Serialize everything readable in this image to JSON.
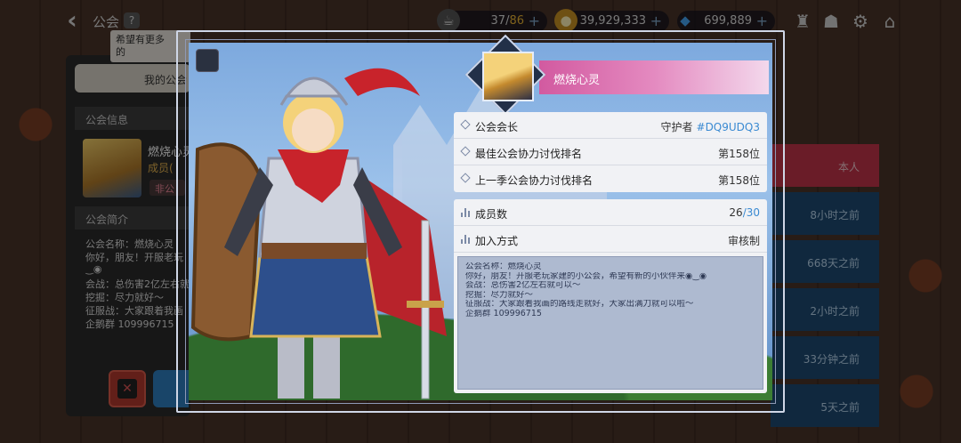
{
  "topbar": {
    "title": "公会",
    "help": "?",
    "stamina": {
      "current": "37",
      "max": "86"
    },
    "gold": "39,929,333",
    "gems": "699,889",
    "plus": "+"
  },
  "left_panel": {
    "tooltip": [
      "希望有更多",
      "的"
    ],
    "my_guild_tab": "我的公会",
    "guild_info_header": "公会信息",
    "leader_name": "燃烧心灵",
    "leader_sub": "成员(",
    "leader_tag": "非公",
    "intro_header": "公会简介",
    "intro_lines": [
      "公会名称：燃烧心灵",
      "你好，朋友！开服老玩",
      "‿◉",
      "会战：总伤害2亿左右就",
      "挖掘：尽力就好～",
      "征服战：大家跟着我画",
      "企鹅群 109996715"
    ]
  },
  "member_list": {
    "rows": [
      "本人",
      "8小时之前",
      "668天之前",
      "2小时之前",
      "33分钟之前",
      "5天之前"
    ]
  },
  "guild_card": {
    "name": "燃烧心灵",
    "rows": {
      "leader_label": "公会会长",
      "leader_role": "守护者",
      "leader_id": "#DQ9UDQ3",
      "best_rank_label": "最佳公会协力讨伐排名",
      "best_rank_value": "第158位",
      "last_rank_label": "上一季公会协力讨伐排名",
      "last_rank_value": "第158位",
      "members_label": "成员数",
      "members_current": "26",
      "members_total": "/30",
      "join_label": "加入方式",
      "join_value": "审核制"
    },
    "description": [
      "公会名称：燃烧心灵",
      "你好，朋友！开服老玩家建的小公会，希望有新的小伙伴来◉‿◉",
      "会战：总伤害2亿左右就可以～",
      "挖掘：尽力就好～",
      "征服战：大家跟着我画的路线走就好，大家出满刀就可以啦～",
      "企鹅群 109996715"
    ]
  },
  "colors": {
    "accent_blue": "#3a8ad2",
    "banner_pink": "#d25aa0",
    "gold": "#e8b233"
  }
}
